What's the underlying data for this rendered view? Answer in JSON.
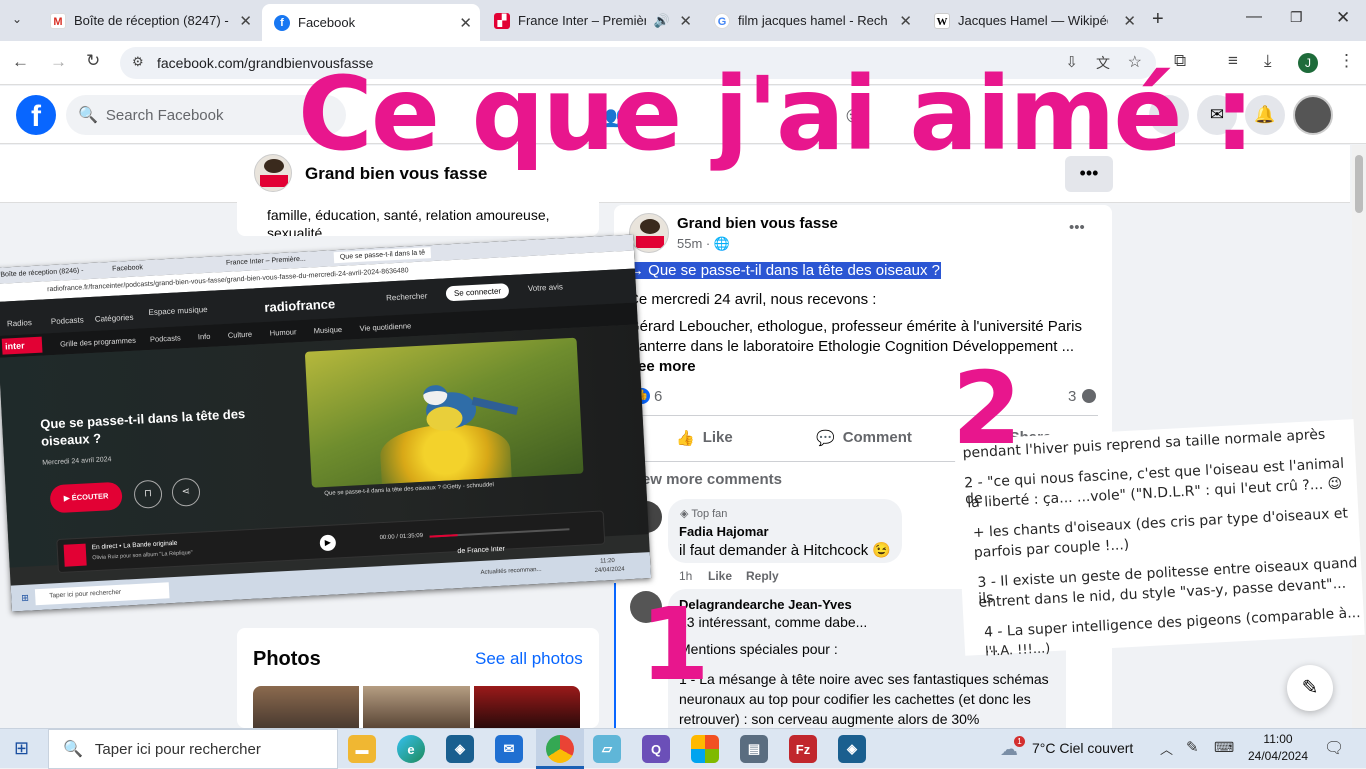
{
  "browser": {
    "tabs": [
      {
        "label": "Boîte de réception (8247) -",
        "icon": "gmail-icon"
      },
      {
        "label": "Facebook",
        "icon": "facebook-icon"
      },
      {
        "label": "France Inter – Première",
        "icon": "radiofrance-icon"
      },
      {
        "label": "film jacques hamel - Recher",
        "icon": "google-icon"
      },
      {
        "label": "Jacques Hamel — Wikipédi",
        "icon": "wikipedia-icon"
      }
    ],
    "url": "facebook.com/grandbienvousfasse",
    "profile_initial": "J"
  },
  "facebook": {
    "search_placeholder": "Search Facebook",
    "page_name": "Grand bien vous fasse",
    "sidebar_text": "famille, éducation, santé, relation amoureuse, sexualité...",
    "photos_title": "Photos",
    "see_all_photos": "See all photos",
    "post": {
      "author": "Grand bien vous fasse",
      "time": "55m · ",
      "highlight": "→ Que se passe-t-il dans la tête des oiseaux ?",
      "line1": "Ce mercredi 24 avril, nous recevons :",
      "line2": "Gérard Leboucher, ethologue, professeur émérite à l'université Paris Nanterre dans le laboratoire Ethologie Cognition Développement ...",
      "see_more": "See more",
      "likes": "6",
      "comments_count": "3",
      "like_label": "Like",
      "comment_label": "Comment",
      "share_label": "Share",
      "view_more": "View more comments"
    },
    "comments": [
      {
        "badge": "Top fan",
        "author": "Fadia Hajomar",
        "text": "il faut demander à Hitchcock 😉",
        "time": "1h",
        "like": "Like",
        "reply": "Reply"
      },
      {
        "author": "Delagrandearche Jean-Yves",
        "text1": "13 intéressant, comme dabe...",
        "text2": "Mentions spéciales pour :",
        "text3": "1 - La mésange à tête noire avec ses fantastiques schémas neuronaux au top pour codifier les cachettes (et donc les retrouver) : son cerveau augmente alors de 30%"
      }
    ]
  },
  "overlay": {
    "title": "Ce que j'ai aimé :",
    "num1": "1",
    "num2": "2",
    "notes": [
      "pendant l'hiver puis reprend sa taille normale après",
      "2 - \"ce qui nous fascine, c'est que l'oiseau est l'animal de",
      "la liberté : ça... ...vole\" (\"N.D.L.R\" : qui l'eut crû ?... 😉",
      "+ les chants d'oiseaux (des cris par type d'oiseaux et",
      "parfois par couple !...)",
      "3 - Il existe un geste de politesse entre oiseaux quand ils",
      "entrent dans le nid, du style \"vas-y, passe devant\"...",
      "4 - La super intelligence des pigeons (comparable à... ...",
      "l'I.A. !!!...)"
    ]
  },
  "embedded": {
    "tabs": [
      "Boîte de réception (8246) -",
      "Facebook",
      "France Inter – Première...",
      "Que se passe-t-il dans la tê"
    ],
    "url": "radiofrance.fr/franceinter/podcasts/grand-bien-vous-fasse/grand-bien-vous-fasse-du-mercredi-24-avril-2024-8636480",
    "brand": "radiofrance",
    "nav": [
      "Radios",
      "Podcasts",
      "Catégories",
      "Espace musique"
    ],
    "search": "Rechercher",
    "connect": "Se connecter",
    "votre": "Votre avis",
    "subnav": [
      "Grille des programmes",
      "Podcasts",
      "Info",
      "Culture",
      "Humour",
      "Musique",
      "Vie quotidienne"
    ],
    "logo_top": "france",
    "logo_main": "inter",
    "title": "Que se passe-t-il dans la tête des oiseaux ?",
    "date": "Mercredi 24 avril 2024",
    "listen": "ÉCOUTER",
    "caption": "Que se passe-t-il dans la tête des oiseaux ? ©Getty - schnuddel",
    "player_live": "En direct • La Bande originale",
    "player_sub": "Olivia Ruiz pour son album \"La Réplique\"",
    "player_time": "00:00 / 01:35:09",
    "player_right": "de France Inter",
    "task_search": "Taper ici pour rechercher",
    "task_news": "Actualités recomman...",
    "task_time": "11:20",
    "task_date": "24/04/2024"
  },
  "taskbar": {
    "search": "Taper ici pour rechercher",
    "weather": "7°C  Ciel couvert",
    "time": "11:00",
    "date": "24/04/2024",
    "weather_badge": "1"
  }
}
